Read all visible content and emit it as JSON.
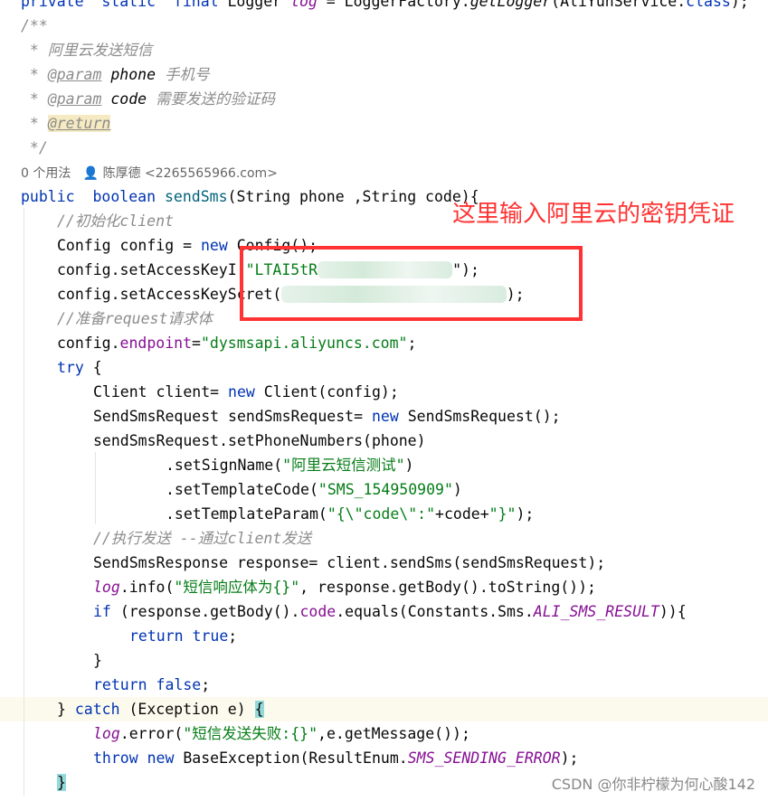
{
  "lines": [
    {
      "t": [
        [
          "private  ",
          "kw"
        ],
        [
          "static  ",
          "kw"
        ],
        [
          "final ",
          "kw"
        ],
        [
          "Logger ",
          ""
        ],
        [
          "log",
          "ifld"
        ],
        [
          " = LoggerFactory.",
          ""
        ],
        [
          "getLogger",
          "mi"
        ],
        [
          "(AliYunService.",
          ""
        ],
        [
          "class",
          "kw"
        ],
        [
          ");",
          ""
        ]
      ],
      "i": 0
    },
    {
      "t": [
        [
          "/**",
          "doc"
        ]
      ],
      "i": 0
    },
    {
      "t": [
        [
          " * 阿里云发送短信",
          "doc"
        ]
      ],
      "i": 0
    },
    {
      "t": [
        [
          " * ",
          "doc"
        ],
        [
          "@param",
          "tag"
        ],
        [
          " phone",
          "pn"
        ],
        [
          " 手机号",
          "doc"
        ]
      ],
      "i": 0
    },
    {
      "t": [
        [
          " * ",
          "doc"
        ],
        [
          "@param",
          "tag"
        ],
        [
          " code",
          "pn"
        ],
        [
          " 需要发送的验证码",
          "doc"
        ]
      ],
      "i": 0
    },
    {
      "t": [
        [
          " * ",
          "doc"
        ],
        [
          "@return",
          "tag tagbg"
        ]
      ],
      "i": 0
    },
    {
      "t": [
        [
          " */",
          "doc"
        ]
      ],
      "i": 0
    },
    {
      "t": [
        [
          "0 个用法   👤 陈厚德 <2265565966.com>",
          "meta"
        ]
      ],
      "i": 0
    },
    {
      "t": [
        [
          "public  ",
          "kw"
        ],
        [
          "boolean ",
          "kw"
        ],
        [
          "sendSms",
          "fn"
        ],
        [
          "(String phone ,String code){",
          ""
        ]
      ],
      "i": 0
    },
    {
      "t": [
        [
          "//初始化client",
          "cm"
        ]
      ],
      "i": 1
    },
    {
      "t": [
        [
          "Config config = ",
          ""
        ],
        [
          "new ",
          "kw"
        ],
        [
          "Config();",
          ""
        ]
      ],
      "i": 1
    },
    {
      "t": [
        [
          "config.setAccessKeyI",
          ""
        ],
        [
          "(\"LTAI5tR",
          "str"
        ],
        [
          "xxxxxxxxxxxxxxx",
          "blur"
        ],
        [
          "\");",
          ""
        ]
      ],
      "i": 1
    },
    {
      "t": [
        [
          "config.setAccessKeyS",
          ""
        ],
        [
          "cret(",
          ""
        ],
        [
          "xxxxxxxxxxxxxxxxxxxxxxxxx",
          "blur"
        ],
        [
          ");",
          ""
        ]
      ],
      "i": 1
    },
    {
      "t": [
        [
          "//准备request请求体",
          "cm"
        ]
      ],
      "i": 1
    },
    {
      "t": [
        [
          "config.",
          ""
        ],
        [
          "endpoint",
          "fld"
        ],
        [
          "=",
          ""
        ],
        [
          "\"dysmsapi.aliyuncs.com\"",
          "str"
        ],
        [
          ";",
          ""
        ]
      ],
      "i": 1
    },
    {
      "t": [
        [
          "try ",
          "kw"
        ],
        [
          "{",
          ""
        ]
      ],
      "i": 1
    },
    {
      "t": [
        [
          "Client client= ",
          ""
        ],
        [
          "new ",
          "kw"
        ],
        [
          "Client(config);",
          ""
        ]
      ],
      "i": 2
    },
    {
      "t": [
        [
          "SendSmsRequest sendSmsRequest= ",
          ""
        ],
        [
          "new ",
          "kw"
        ],
        [
          "SendSmsRequest();",
          ""
        ]
      ],
      "i": 2
    },
    {
      "t": [
        [
          "sendSmsRequest.setPhoneNumbers(phone)",
          ""
        ]
      ],
      "i": 2
    },
    {
      "t": [
        [
          ".setSignName(",
          ""
        ],
        [
          "\"阿里云短信测试\"",
          "str"
        ],
        [
          ")",
          ""
        ]
      ],
      "i": 4
    },
    {
      "t": [
        [
          ".setTemplateCode(",
          ""
        ],
        [
          "\"SMS_154950909\"",
          "str"
        ],
        [
          ")",
          ""
        ]
      ],
      "i": 4
    },
    {
      "t": [
        [
          ".setTemplateParam(",
          ""
        ],
        [
          "\"{\\\"code\\\":\"",
          "str"
        ],
        [
          "+code+",
          ""
        ],
        [
          "\"}\"",
          "str"
        ],
        [
          ");",
          ""
        ]
      ],
      "i": 4
    },
    {
      "t": [
        [
          "//执行发送 --通过client发送",
          "cm"
        ]
      ],
      "i": 2
    },
    {
      "t": [
        [
          "SendSmsResponse response= client.sendSms(sendSmsRequest);",
          ""
        ]
      ],
      "i": 2
    },
    {
      "t": [
        [
          "log",
          "ifld"
        ],
        [
          ".info(",
          ""
        ],
        [
          "\"短信响应体为{}\"",
          "str"
        ],
        [
          ", response.getBody().toString());",
          ""
        ]
      ],
      "i": 2
    },
    {
      "t": [
        [
          "if ",
          "kw"
        ],
        [
          "(response.getBody().",
          ""
        ],
        [
          "code",
          "fld"
        ],
        [
          ".equals(Constants.Sms.",
          ""
        ],
        [
          "ALI_SMS_RESULT",
          "ifld"
        ],
        [
          ")){",
          ""
        ]
      ],
      "i": 2
    },
    {
      "t": [
        [
          "return ",
          "kw"
        ],
        [
          "true",
          "kw"
        ],
        [
          ";",
          ""
        ]
      ],
      "i": 3
    },
    {
      "t": [
        [
          "}",
          ""
        ]
      ],
      "i": 2
    },
    {
      "t": [
        [
          "return ",
          "kw"
        ],
        [
          "false",
          "kw"
        ],
        [
          ";",
          ""
        ]
      ],
      "i": 2
    },
    {
      "t": [
        [
          "} ",
          ""
        ],
        [
          "catch ",
          "kw"
        ],
        [
          "(Exception e) ",
          ""
        ],
        [
          "{",
          "brace"
        ]
      ],
      "i": 1,
      "cur": true
    },
    {
      "t": [
        [
          "log",
          "ifld"
        ],
        [
          ".error(",
          ""
        ],
        [
          "\"短信发送失败:{}\"",
          "str"
        ],
        [
          ",e.getMessage());",
          ""
        ]
      ],
      "i": 2
    },
    {
      "t": [
        [
          "throw ",
          "kw"
        ],
        [
          "new ",
          "kw"
        ],
        [
          "BaseException(ResultEnum.",
          ""
        ],
        [
          "SMS_SENDING_ERROR",
          "ifld"
        ],
        [
          ");",
          ""
        ]
      ],
      "i": 2
    },
    {
      "t": [
        [
          "}",
          "brace"
        ]
      ],
      "i": 1
    }
  ],
  "annotation": "这里输入阿里云的密钥凭证",
  "watermark": "CSDN @你非柠檬为何心酸142",
  "colors": {
    "annotation": "#ff3333",
    "keyword": "#0033b3",
    "string": "#067d17"
  }
}
